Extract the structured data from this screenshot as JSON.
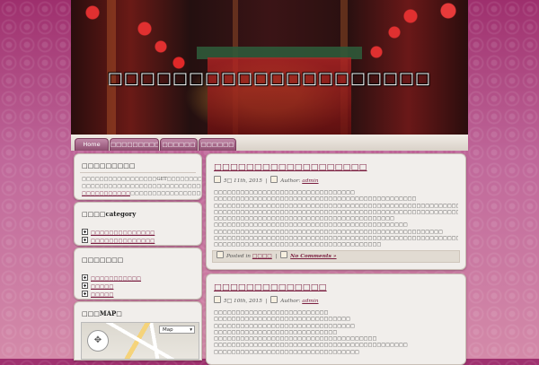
{
  "header": {
    "site_title": "□□□□□□□□□□□□□□□□□□□□"
  },
  "nav": {
    "items": [
      {
        "label": "Home"
      },
      {
        "label": "□□□□□□□□□□"
      },
      {
        "label": "□□□□□□"
      },
      {
        "label": "□□□□□□"
      }
    ]
  },
  "sidebar": {
    "widget1": {
      "title": "□□□□□□□□□",
      "text": [
        "□□□□□□□□□□□□□□□□□GET□□□□□□□□□□□□□□□□□",
        "□□□□□□□□□□□□□□□□□□□□□□□□□□□□□□□□□□□",
        "□□□□□□□□□□□□□□□□□□□"
      ],
      "link": "□□□□□□□□□□□"
    },
    "widget2": {
      "title": "□□□□category",
      "items": [
        "□□□□□□□□□□□□□□",
        "□□□□□□□□□□□□□□"
      ]
    },
    "widget3": {
      "title": "□□□□□□□",
      "items": [
        "□□□□□□□□□□□",
        "□□□□□",
        "□□□□□"
      ]
    },
    "widget4": {
      "title": "□□□MAP□",
      "map_type": "Map",
      "map_icons": {
        "control": "map-pan-control-icon",
        "dropdown": "chevron-down-icon"
      }
    }
  },
  "posts": [
    {
      "title": "□□□□□□□□□□□□□□□□□□□",
      "date": "5□ 11th, 2015",
      "author_label": "Author:",
      "author": "admin",
      "lines": [
        "□□□□□□□□□□□□□□□□□□□□□□□□□□□□□□□□",
        "□□□□□□□□□□□□□□□□□□□□□□□□□□□□□□□□□□□□□□□□□□□□□□",
        "□□□□□□□□□□□□□□□□□□□□□□□□□□□□□□□□□□□□□□□□□□□□□□□□□□□□□□□□□□□□□",
        "□□□□□□□□□□□□□□□□□□□□□□□□□□□□□□□□□□□□□□□□□□□□□□□□□□□□□□□□□□□□□□",
        "□□□□□□□□□□□□□□□□□□□□□□□□□□□□□□□□□□□□□□□□□",
        "□□□□□□□□□□□□□□□□□□□□□□□□□□□□□□□□□□□□□□□□□□□□",
        "□□□□□□□□□□□□□□□□□□□□□□□□□□□□□□□□□□□□□□□□□□□□□□□□□□□□",
        "□□□□□□□□□□□□□□□□□□□□□□□□□□□□□□□□□□□□□□□□□□□□□□□□□□□□□□□□□□□□",
        "□□□□□□□□□□□□□□□□□□□□□□□□□□□□□□□□□□□□□□"
      ],
      "posted_label": "Posted in",
      "category": "□□□□",
      "comments": "No Comments »"
    },
    {
      "title": "□□□□□□□□□□□□□□",
      "date": "5□ 10th, 2015",
      "author_label": "Author:",
      "author": "admin",
      "lines": [
        "□□□□□□□□□□□□□□□□□□□□□□□□□□",
        "□□□□□□□□□□□□□□□□□□□□□□□□□□□□□□□",
        "□□□□□□□□□□□□□□□□□□□□□□□□□□□□□□□□",
        "□□□□□□□□□□□□□□□□□□□□□□□□□□□□",
        "□□□□□□□□□□□□□□□□□□□□□□□□□□□□□□□□□□□□□",
        "□□□□□□□□□□□□□□□□□□□□□□□□□□□□□□□□□□□□□□□□□□□□",
        "□□□□□□□□□□□□□□□□□□□□□□□□□□□□□□□□□"
      ]
    }
  ],
  "colors": {
    "accent": "#7a1e40",
    "nav_tab": "#a86a8c",
    "background": "#b04c83"
  }
}
